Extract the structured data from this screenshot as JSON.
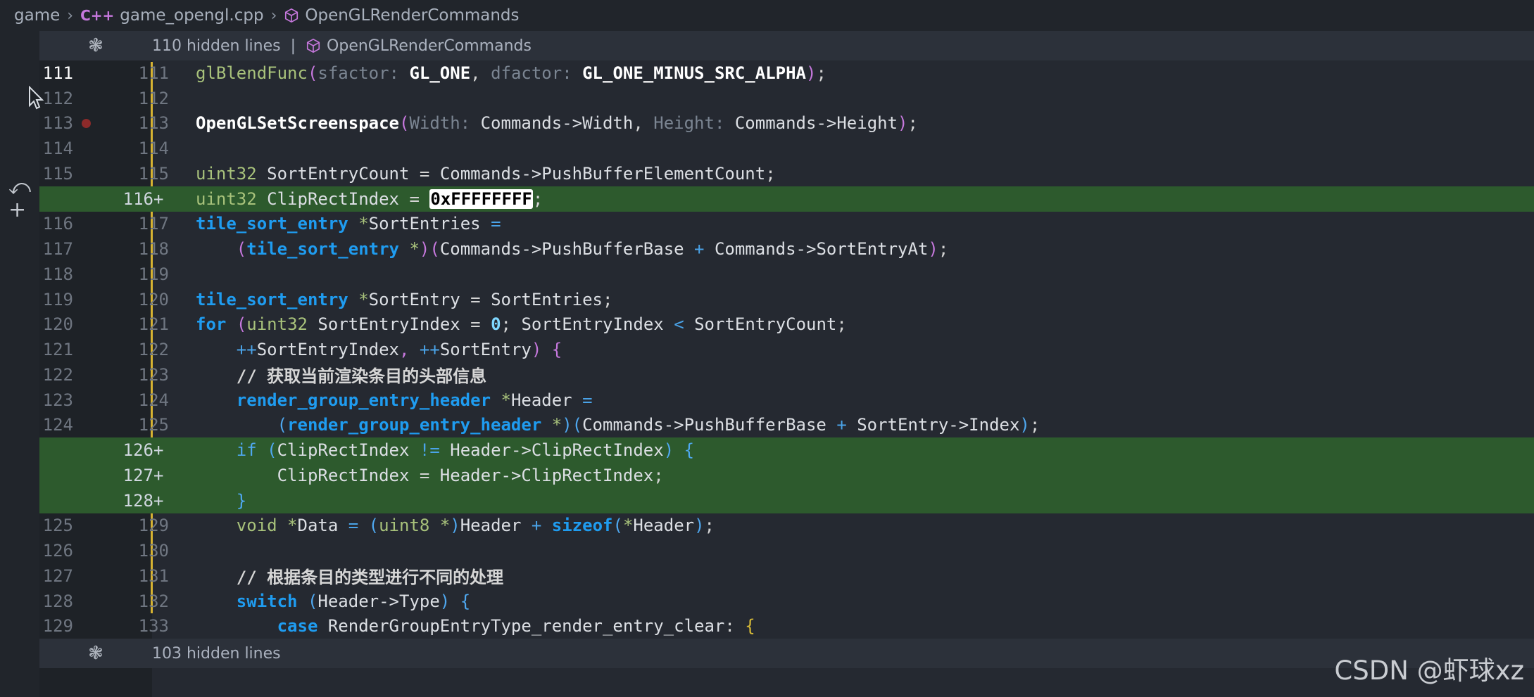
{
  "breadcrumb": {
    "items": [
      "game",
      "game_opengl.cpp",
      "OpenGLRenderCommands"
    ],
    "cpp_badge": "C++"
  },
  "hidden_top": {
    "text": "110 hidden lines",
    "separator": "|",
    "symbol": "OpenGLRenderCommands"
  },
  "hidden_bottom": {
    "text": "103 hidden lines"
  },
  "lines": [
    {
      "old": "111",
      "new": "111"
    },
    {
      "old": "112",
      "new": "112"
    },
    {
      "old": "113",
      "new": "113"
    },
    {
      "old": "114",
      "new": "114"
    },
    {
      "old": "115",
      "new": "115"
    },
    {
      "old": "",
      "new": "116",
      "plus": "+"
    },
    {
      "old": "116",
      "new": "117"
    },
    {
      "old": "117",
      "new": "118"
    },
    {
      "old": "118",
      "new": "119"
    },
    {
      "old": "119",
      "new": "120"
    },
    {
      "old": "120",
      "new": "121"
    },
    {
      "old": "121",
      "new": "122"
    },
    {
      "old": "122",
      "new": "123"
    },
    {
      "old": "123",
      "new": "124"
    },
    {
      "old": "124",
      "new": "125"
    },
    {
      "old": "",
      "new": "126",
      "plus": "+"
    },
    {
      "old": "",
      "new": "127",
      "plus": "+"
    },
    {
      "old": "",
      "new": "128",
      "plus": "+"
    },
    {
      "old": "125",
      "new": "129"
    },
    {
      "old": "126",
      "new": "130"
    },
    {
      "old": "127",
      "new": "131"
    },
    {
      "old": "128",
      "new": "132"
    },
    {
      "old": "129",
      "new": "133"
    }
  ],
  "code": {
    "l111_fn": "glBlendFunc",
    "l111_h1": "sfactor:",
    "l111_a1": "GL_ONE",
    "l111_h2": "dfactor:",
    "l111_a2": "GL_ONE_MINUS_SRC_ALPHA",
    "l113_fn": "OpenGLSetScreenspace",
    "l113_h1": "Width:",
    "l113_a1": "Commands->Width",
    "l113_h2": "Height:",
    "l113_a2": "Commands->Height",
    "l115_t": "uint32",
    "l115_v": "SortEntryCount",
    "l115_e": "Commands->PushBufferElementCount",
    "l116_t": "uint32",
    "l116_v": "ClipRectIndex",
    "l116_e": "0xFFFFFFFF",
    "l117_t": "tile_sort_entry",
    "l117_v": "SortEntries",
    "l118_t": "tile_sort_entry",
    "l118_a": "Commands->PushBufferBase",
    "l118_b": "Commands->SortEntryAt",
    "l120_t": "tile_sort_entry",
    "l120_v": "SortEntry",
    "l120_e": "SortEntries",
    "l121_kw": "for",
    "l121_t": "uint32",
    "l121_v": "SortEntryIndex",
    "l121_n": "0",
    "l121_c1": "SortEntryIndex",
    "l121_c2": "SortEntryCount",
    "l122_a": "SortEntryIndex",
    "l122_b": "SortEntry",
    "l123_cm": "// 获取当前渲染条目的头部信息",
    "l124_t": "render_group_entry_header",
    "l124_v": "Header",
    "l125_t": "render_group_entry_header",
    "l125_a": "Commands->PushBufferBase",
    "l125_b": "SortEntry->Index",
    "l126_kw": "if",
    "l126_a": "ClipRectIndex",
    "l126_b": "Header->ClipRectIndex",
    "l127_a": "ClipRectIndex",
    "l127_b": "Header->ClipRectIndex",
    "l129_t": "void",
    "l129_v": "Data",
    "l129_c": "uint8",
    "l129_h": "Header",
    "l129_s": "sizeof",
    "l129_h2": "Header",
    "l131_cm": "// 根据条目的类型进行不同的处理",
    "l132_kw": "switch",
    "l132_e": "Header->Type",
    "l133_kw": "case",
    "l133_e": "RenderGroupEntryType_render_entry_clear"
  },
  "watermark": "CSDN @虾球xz",
  "icons": [
    "chevron-right-icon",
    "cube-icon",
    "fold-gear-icon",
    "undo-arrow-icon",
    "plus-icon",
    "mouse-cursor-icon"
  ],
  "colors": {
    "added_line": "#2d5a2d",
    "modified_bar": "#d7b332",
    "keyword": "#1f9cf0",
    "breakpoint": "#8c2a2a"
  }
}
